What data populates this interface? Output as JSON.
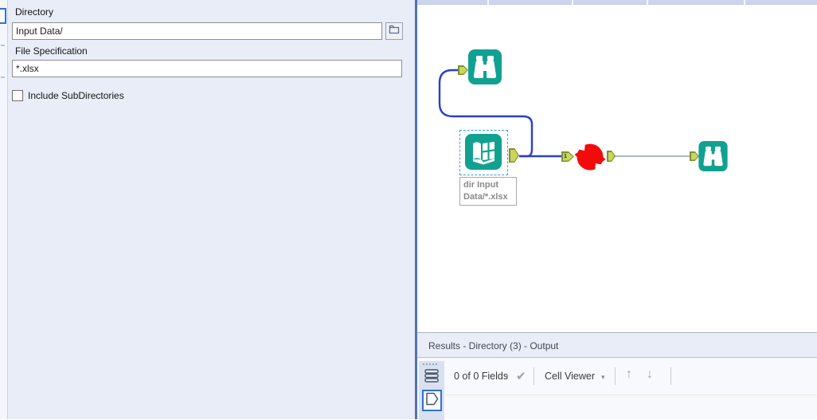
{
  "config": {
    "directory_label": "Directory",
    "directory_value": "Input Data/",
    "file_spec_label": "File Specification",
    "file_spec_value": "*.xlsx",
    "include_subdirs_label": "Include SubDirectories",
    "include_subdirs_checked": false
  },
  "canvas": {
    "tools": [
      {
        "type": "Browse",
        "position": "top-left"
      },
      {
        "type": "Directory",
        "selected": true,
        "annotation": "dir Input Data/*.xlsx"
      },
      {
        "type": "Running-tool",
        "state": "running"
      },
      {
        "type": "Browse",
        "position": "right"
      }
    ],
    "annotation": {
      "line1": "dir Input",
      "line2": "Data/*.xlsx"
    },
    "connection_label": "1"
  },
  "results": {
    "header": "Results - Directory (3) - Output",
    "fields_summary": "0 of 0 Fields",
    "cell_viewer_label": "Cell Viewer",
    "check_icon": "✔",
    "caret_icon": "▾",
    "up_arrow_icon": "↑",
    "down_arrow_icon": "↓"
  },
  "colors": {
    "tool_teal": "#11a191",
    "running_red": "#f30b0b",
    "wire_blue": "#2b3ecc",
    "wire_gray": "#9aa0a6",
    "anchor_green": "#c9d65a",
    "panel_bg": "#e9edf8",
    "selection_blue": "#3aa0dc"
  }
}
